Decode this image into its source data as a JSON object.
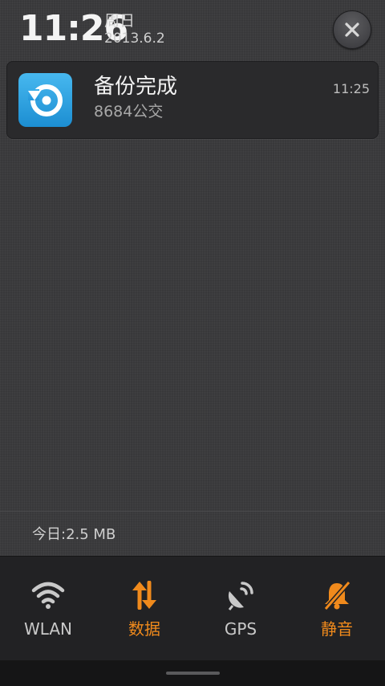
{
  "header": {
    "time": "11:26",
    "day": "周日",
    "date": "2013.6.2"
  },
  "notification": {
    "title": "备份完成",
    "subtitle": "8684公交",
    "time": "11:25",
    "icon": "backup-restore-icon"
  },
  "usage": {
    "text": "今日:2.5 MB"
  },
  "toggles": [
    {
      "label": "WLAN",
      "icon": "wifi-icon",
      "state": "off"
    },
    {
      "label": "数据",
      "icon": "data-sync-icon",
      "state": "on"
    },
    {
      "label": "GPS",
      "icon": "gps-satellite-icon",
      "state": "off"
    },
    {
      "label": "静音",
      "icon": "mute-bell-icon",
      "state": "on"
    }
  ],
  "colors": {
    "accent": "#f08a1c",
    "off": "#c9c9c9",
    "app_icon": "#2ea6e6"
  }
}
